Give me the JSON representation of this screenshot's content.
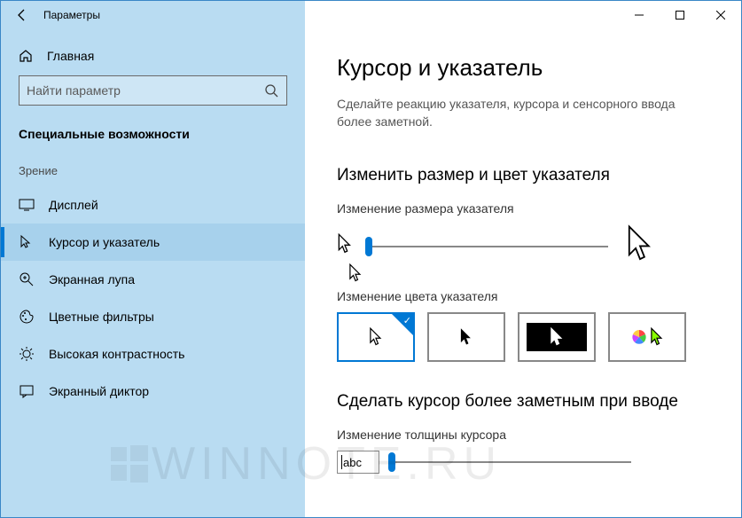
{
  "window": {
    "title": "Параметры"
  },
  "sidebar": {
    "home_label": "Главная",
    "search_placeholder": "Найти параметр",
    "section": "Специальные возможности",
    "group": "Зрение",
    "items": [
      {
        "label": "Дисплей"
      },
      {
        "label": "Курсор и указатель",
        "active": true
      },
      {
        "label": "Экранная лупа"
      },
      {
        "label": "Цветные фильтры"
      },
      {
        "label": "Высокая контрастность"
      },
      {
        "label": "Экранный диктор"
      }
    ]
  },
  "page": {
    "title": "Курсор и указатель",
    "desc": "Сделайте реакцию указателя, курсора и сенсорного ввода более заметной.",
    "section1_title": "Изменить размер и цвет указателя",
    "size_label": "Изменение размера указателя",
    "color_label": "Изменение цвета указателя",
    "section2_title": "Сделать курсор более заметным при вводе",
    "thickness_label": "Изменение толщины курсора",
    "thickness_preview": "abc"
  },
  "watermark": "WINNOTE.RU"
}
